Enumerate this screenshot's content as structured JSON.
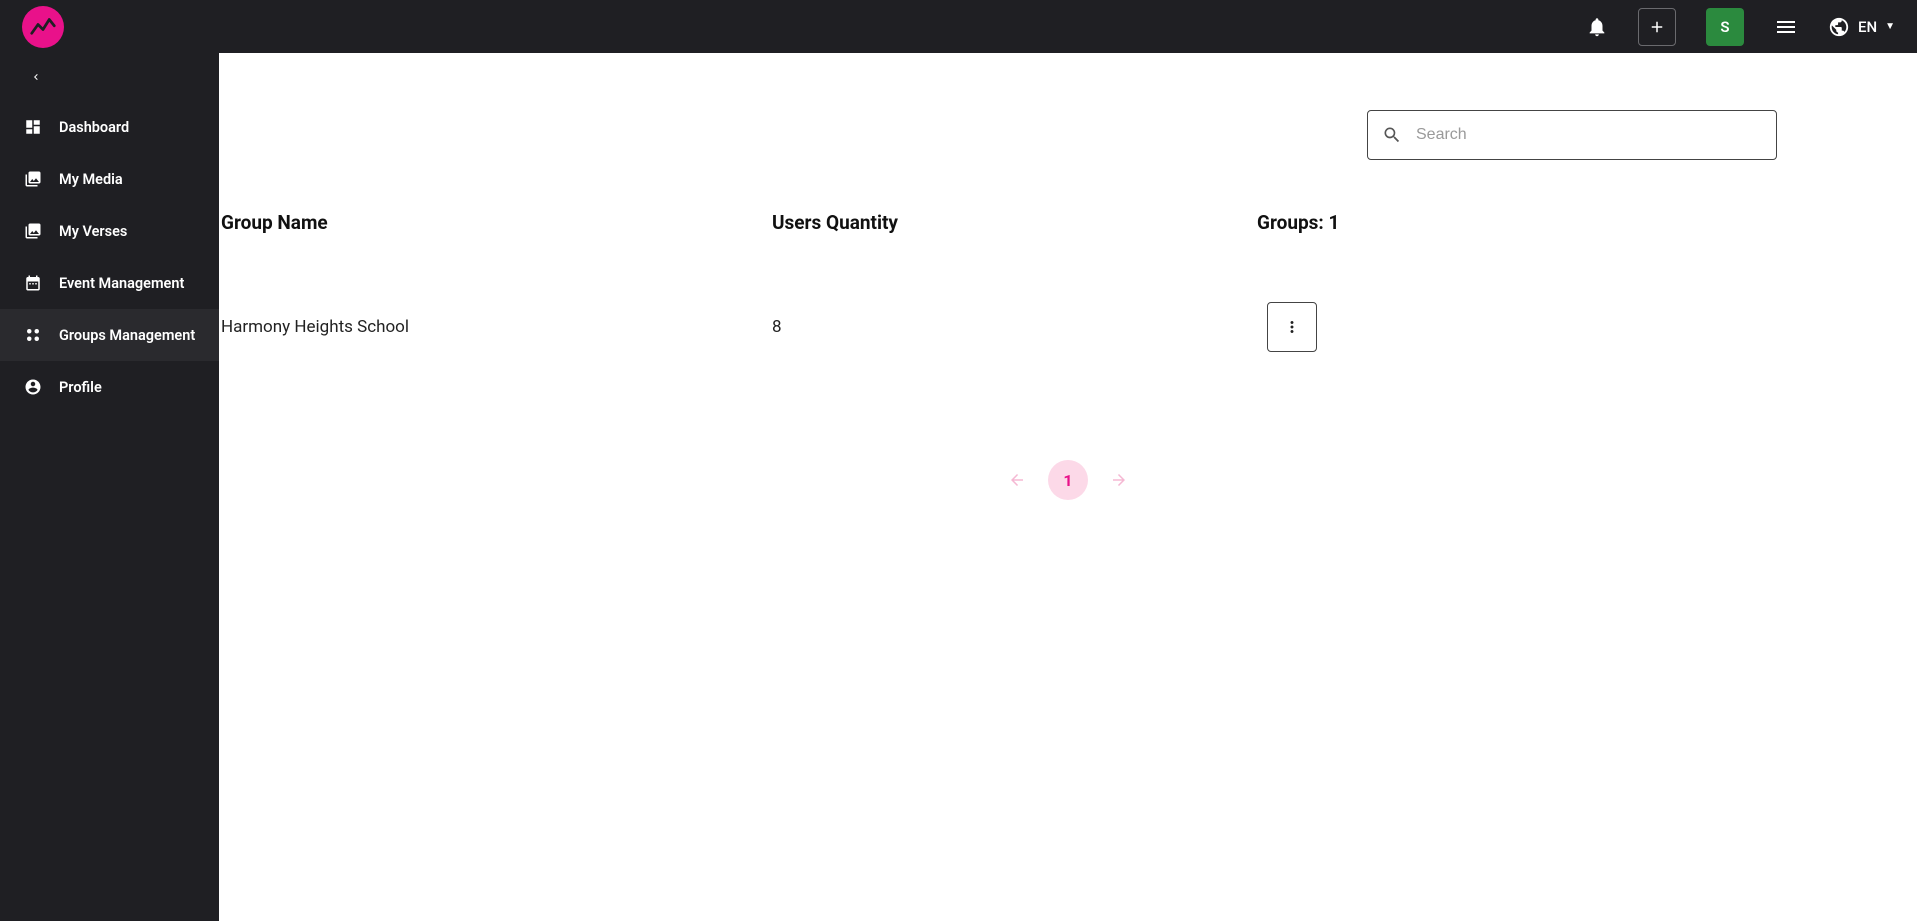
{
  "header": {
    "avatar_letter": "S",
    "language_label": "EN"
  },
  "sidebar": {
    "items": [
      {
        "label": "Dashboard"
      },
      {
        "label": "My Media"
      },
      {
        "label": "My Verses"
      },
      {
        "label": "Event Management"
      },
      {
        "label": "Groups Management"
      },
      {
        "label": "Profile"
      }
    ]
  },
  "search": {
    "placeholder": "Search",
    "value": ""
  },
  "table": {
    "headers": {
      "name": "Group Name",
      "users": "Users Quantity",
      "groups_label": "Groups: 1"
    },
    "rows": [
      {
        "name": "Harmony Heights School",
        "users": "8"
      }
    ]
  },
  "pagination": {
    "current": "1"
  }
}
